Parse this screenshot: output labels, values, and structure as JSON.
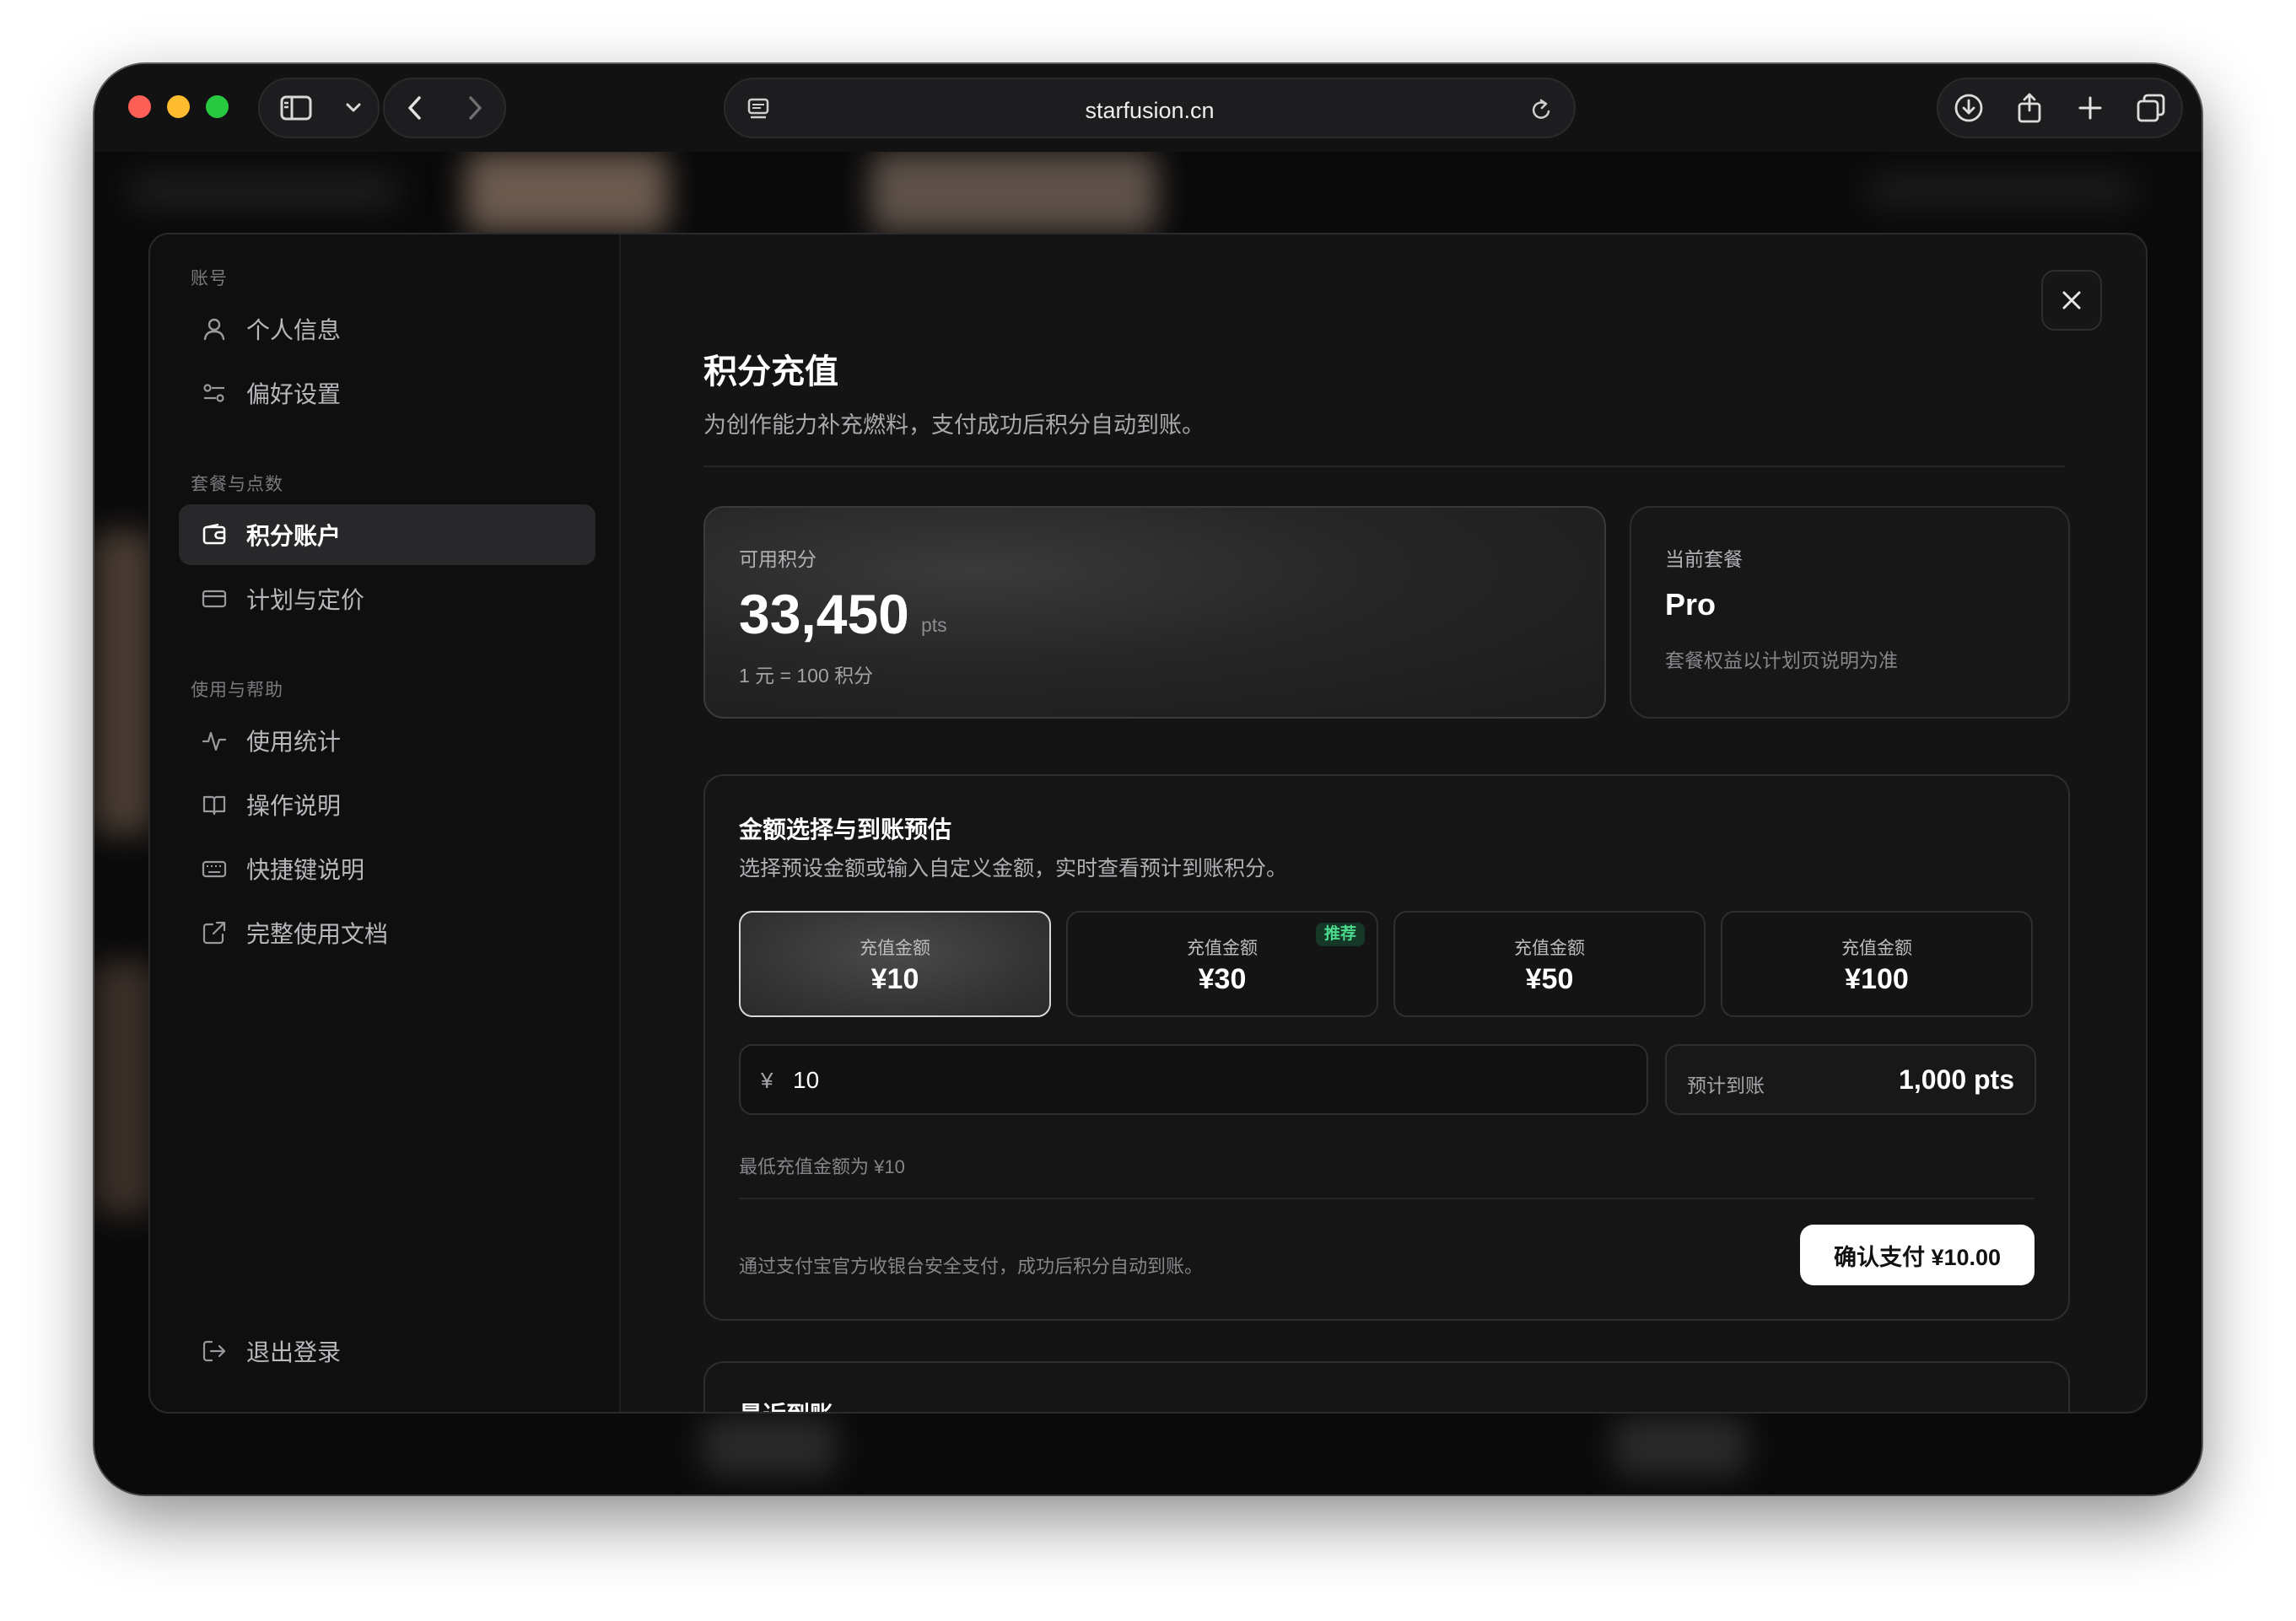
{
  "browser": {
    "url": "starfusion.cn"
  },
  "sidebar": {
    "sections": [
      {
        "label": "账号",
        "items": [
          {
            "label": "个人信息",
            "icon": "user-icon"
          },
          {
            "label": "偏好设置",
            "icon": "sliders-icon"
          }
        ]
      },
      {
        "label": "套餐与点数",
        "items": [
          {
            "label": "积分账户",
            "icon": "wallet-icon",
            "active": true
          },
          {
            "label": "计划与定价",
            "icon": "credit-card-icon"
          }
        ]
      },
      {
        "label": "使用与帮助",
        "items": [
          {
            "label": "使用统计",
            "icon": "activity-icon"
          },
          {
            "label": "操作说明",
            "icon": "book-icon"
          },
          {
            "label": "快捷键说明",
            "icon": "keyboard-icon"
          },
          {
            "label": "完整使用文档",
            "icon": "external-link-icon"
          }
        ]
      }
    ],
    "logout": {
      "label": "退出登录",
      "icon": "logout-icon"
    }
  },
  "main": {
    "title": "积分充值",
    "subtitle": "为创作能力补充燃料，支付成功后积分自动到账。",
    "balance": {
      "label": "可用积分",
      "value": "33,450",
      "unit": "pts",
      "rate": "1 元 = 100 积分"
    },
    "plan": {
      "label": "当前套餐",
      "name": "Pro",
      "note": "套餐权益以计划页说明为准"
    },
    "amount": {
      "title": "金额选择与到账预估",
      "desc": "选择预设金额或输入自定义金额，实时查看预计到账积分。",
      "options": [
        {
          "label": "充值金额",
          "value": "¥10",
          "selected": true
        },
        {
          "label": "充值金额",
          "value": "¥30",
          "badge": "推荐"
        },
        {
          "label": "充值金额",
          "value": "¥50"
        },
        {
          "label": "充值金额",
          "value": "¥100"
        }
      ],
      "currency_symbol": "¥",
      "input_value": "10",
      "estimate_label": "预计到账",
      "estimate_value": "1,000 pts",
      "min_note": "最低充值金额为 ¥10",
      "pay_note": "通过支付宝官方收银台安全支付，成功后积分自动到账。",
      "pay_button": "确认支付 ¥10.00"
    },
    "recent": {
      "title": "最近到账"
    }
  },
  "colors": {
    "background": "#0b0b0c",
    "panel": "#141414",
    "accent_text": "#ffffff",
    "badge_green": "#4ad98d"
  }
}
